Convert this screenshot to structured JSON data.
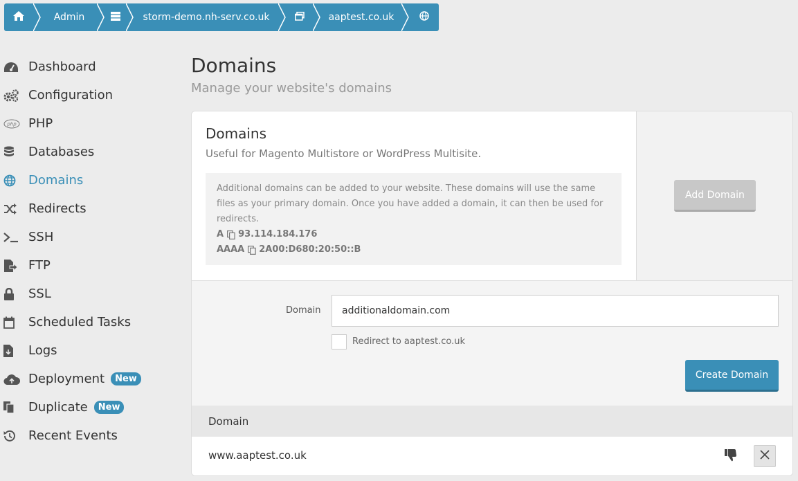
{
  "breadcrumb": {
    "items": [
      {
        "icon": "home-icon"
      },
      {
        "label": "Admin"
      },
      {
        "icon": "server-icon"
      },
      {
        "label": "storm-demo.nh-serv.co.uk"
      },
      {
        "icon": "window-icon"
      },
      {
        "label": "aaptest.co.uk"
      },
      {
        "icon": "globe-icon"
      }
    ]
  },
  "sidebar": {
    "items": [
      {
        "label": "Dashboard",
        "icon": "dashboard-icon"
      },
      {
        "label": "Configuration",
        "icon": "cogs-icon"
      },
      {
        "label": "PHP",
        "icon": "php-icon"
      },
      {
        "label": "Databases",
        "icon": "database-icon"
      },
      {
        "label": "Domains",
        "icon": "globe-icon",
        "active": true
      },
      {
        "label": "Redirects",
        "icon": "shuffle-icon"
      },
      {
        "label": "SSH",
        "icon": "terminal-icon"
      },
      {
        "label": "FTP",
        "icon": "file-export-icon"
      },
      {
        "label": "SSL",
        "icon": "lock-icon"
      },
      {
        "label": "Scheduled Tasks",
        "icon": "calendar-icon"
      },
      {
        "label": "Logs",
        "icon": "file-download-icon"
      },
      {
        "label": "Deployment",
        "icon": "cloud-upload-icon",
        "badge": "New"
      },
      {
        "label": "Duplicate",
        "icon": "copy-icon",
        "badge": "New"
      },
      {
        "label": "Recent Events",
        "icon": "history-icon"
      }
    ]
  },
  "page": {
    "title": "Domains",
    "subtitle": "Manage your website's domains"
  },
  "panel": {
    "title": "Domains",
    "subtitle": "Useful for Magento Multistore or WordPress Multisite.",
    "info_text": "Additional domains can be added to your website. These domains will use the same files as your primary domain. Once you have added a domain, it can then be used for redirects.",
    "records": [
      {
        "type": "A",
        "value": "93.114.184.176"
      },
      {
        "type": "AAAA",
        "value": "2A00:D680:20:50::B"
      }
    ],
    "add_button": "Add Domain"
  },
  "form": {
    "domain_label": "Domain",
    "domain_value": "additionaldomain.com",
    "redirect_label": "Redirect to aaptest.co.uk",
    "create_button": "Create Domain"
  },
  "table": {
    "header": "Domain",
    "rows": [
      {
        "domain": "www.aaptest.co.uk"
      }
    ]
  },
  "colors": {
    "accent": "#3a8fb7",
    "background": "#ececec"
  }
}
